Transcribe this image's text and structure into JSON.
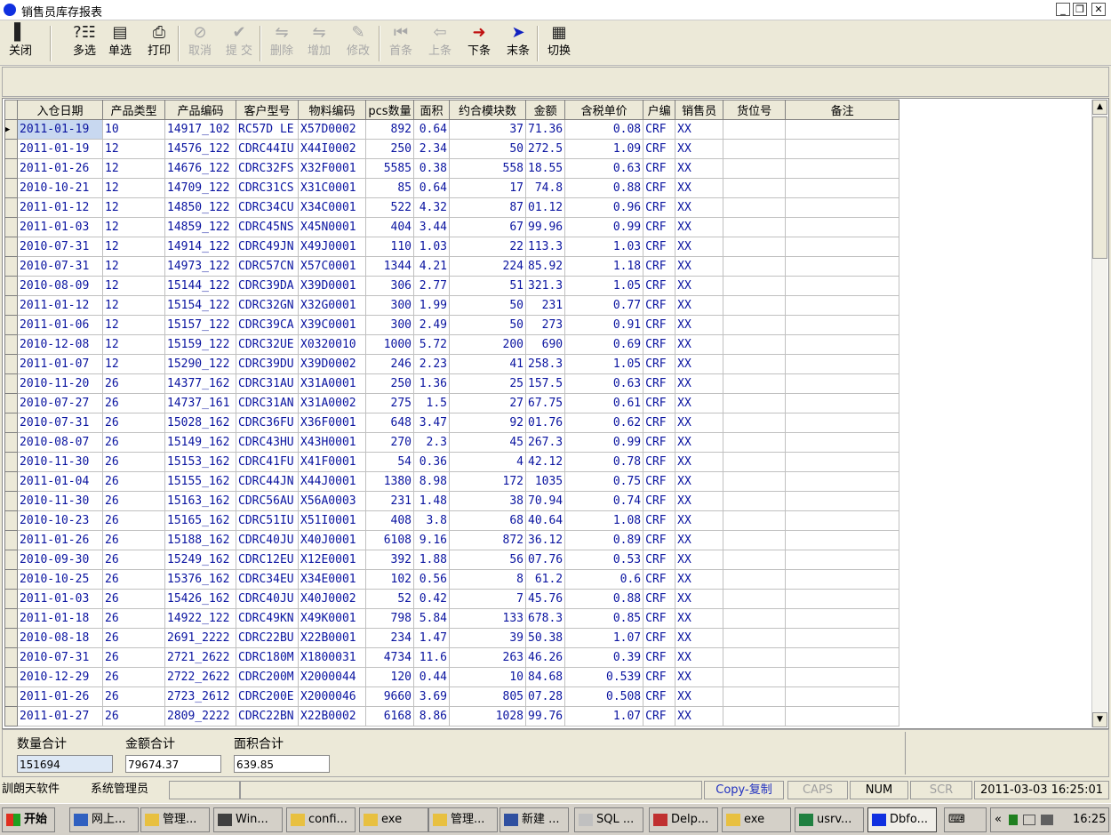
{
  "window": {
    "title": "销售员库存报表",
    "min": "_",
    "restore": "❐",
    "close": "✕"
  },
  "toolbar": [
    {
      "label": "关闭",
      "icon": "exit-door-icon",
      "glyph": "▌",
      "enabled": true
    },
    {
      "label": "多选",
      "icon": "multi-select-icon",
      "glyph": "?☷",
      "enabled": true
    },
    {
      "label": "单选",
      "icon": "single-select-icon",
      "glyph": "▤",
      "enabled": true
    },
    {
      "label": "打印",
      "icon": "printer-icon",
      "glyph": "⎙",
      "enabled": true
    },
    {
      "label": "取消",
      "icon": "cancel-icon",
      "glyph": "⊘",
      "enabled": false
    },
    {
      "label": "提 交",
      "icon": "checkmark-icon",
      "glyph": "✔",
      "enabled": false
    },
    {
      "label": "删除",
      "icon": "delete-row-icon",
      "glyph": "⇋",
      "enabled": false
    },
    {
      "label": "增加",
      "icon": "add-row-icon",
      "glyph": "⇋",
      "enabled": false
    },
    {
      "label": "修改",
      "icon": "edit-icon",
      "glyph": "✎",
      "enabled": false
    },
    {
      "label": "首条",
      "icon": "first-record-icon",
      "glyph": "⏮",
      "enabled": false
    },
    {
      "label": "上条",
      "icon": "prev-record-icon",
      "glyph": "⇦",
      "enabled": false
    },
    {
      "label": "下条",
      "icon": "next-record-icon",
      "glyph": "➜",
      "enabled": true
    },
    {
      "label": "末条",
      "icon": "last-record-icon",
      "glyph": "➤",
      "enabled": true
    },
    {
      "label": "切换",
      "icon": "grid-toggle-icon",
      "glyph": "▦",
      "enabled": true
    }
  ],
  "grid": {
    "columns": [
      "入仓日期",
      "产品类型",
      "产品编码",
      "客户型号",
      "物料编码",
      "pcs数量",
      "面积",
      "约合模块数",
      "金额",
      "含税单价",
      "户编",
      "销售员",
      "货位号",
      "备注"
    ],
    "rows": [
      [
        "2011-01-19",
        "10",
        "14917_102",
        "RC57D LE",
        "X57D0002",
        "892",
        "0.64",
        "37",
        "71.36",
        "0.08",
        "CRF",
        "XX",
        "",
        ""
      ],
      [
        "2011-01-19",
        "12",
        "14576_122",
        "CDRC44IU",
        "X44I0002",
        "250",
        "2.34",
        "50",
        "272.5",
        "1.09",
        "CRF",
        "XX",
        "",
        ""
      ],
      [
        "2011-01-26",
        "12",
        "14676_122",
        "CDRC32FS",
        "X32F0001",
        "5585",
        "0.38",
        "558",
        "18.55",
        "0.63",
        "CRF",
        "XX",
        "",
        ""
      ],
      [
        "2010-10-21",
        "12",
        "14709_122",
        "CDRC31CS",
        "X31C0001",
        "85",
        "0.64",
        "17",
        "74.8",
        "0.88",
        "CRF",
        "XX",
        "",
        ""
      ],
      [
        "2011-01-12",
        "12",
        "14850_122",
        "CDRC34CU",
        "X34C0001",
        "522",
        "4.32",
        "87",
        "01.12",
        "0.96",
        "CRF",
        "XX",
        "",
        ""
      ],
      [
        "2011-01-03",
        "12",
        "14859_122",
        "CDRC45NS",
        "X45N0001",
        "404",
        "3.44",
        "67",
        "99.96",
        "0.99",
        "CRF",
        "XX",
        "",
        ""
      ],
      [
        "2010-07-31",
        "12",
        "14914_122",
        "CDRC49JN",
        "X49J0001",
        "110",
        "1.03",
        "22",
        "113.3",
        "1.03",
        "CRF",
        "XX",
        "",
        ""
      ],
      [
        "2010-07-31",
        "12",
        "14973_122",
        "CDRC57CN",
        "X57C0001",
        "1344",
        "4.21",
        "224",
        "85.92",
        "1.18",
        "CRF",
        "XX",
        "",
        ""
      ],
      [
        "2010-08-09",
        "12",
        "15144_122",
        "CDRC39DA",
        "X39D0001",
        "306",
        "2.77",
        "51",
        "321.3",
        "1.05",
        "CRF",
        "XX",
        "",
        ""
      ],
      [
        "2011-01-12",
        "12",
        "15154_122",
        "CDRC32GN",
        "X32G0001",
        "300",
        "1.99",
        "50",
        "231",
        "0.77",
        "CRF",
        "XX",
        "",
        ""
      ],
      [
        "2011-01-06",
        "12",
        "15157_122",
        "CDRC39CA",
        "X39C0001",
        "300",
        "2.49",
        "50",
        "273",
        "0.91",
        "CRF",
        "XX",
        "",
        ""
      ],
      [
        "2010-12-08",
        "12",
        "15159_122",
        "CDRC32UE",
        "X0320010",
        "1000",
        "5.72",
        "200",
        "690",
        "0.69",
        "CRF",
        "XX",
        "",
        ""
      ],
      [
        "2011-01-07",
        "12",
        "15290_122",
        "CDRC39DU",
        "X39D0002",
        "246",
        "2.23",
        "41",
        "258.3",
        "1.05",
        "CRF",
        "XX",
        "",
        ""
      ],
      [
        "2010-11-20",
        "26",
        "14377_162",
        "CDRC31AU",
        "X31A0001",
        "250",
        "1.36",
        "25",
        "157.5",
        "0.63",
        "CRF",
        "XX",
        "",
        ""
      ],
      [
        "2010-07-27",
        "26",
        "14737_161",
        "CDRC31AN",
        "X31A0002",
        "275",
        "1.5",
        "27",
        "67.75",
        "0.61",
        "CRF",
        "XX",
        "",
        ""
      ],
      [
        "2010-07-31",
        "26",
        "15028_162",
        "CDRC36FU",
        "X36F0001",
        "648",
        "3.47",
        "92",
        "01.76",
        "0.62",
        "CRF",
        "XX",
        "",
        ""
      ],
      [
        "2010-08-07",
        "26",
        "15149_162",
        "CDRC43HU",
        "X43H0001",
        "270",
        "2.3",
        "45",
        "267.3",
        "0.99",
        "CRF",
        "XX",
        "",
        ""
      ],
      [
        "2010-11-30",
        "26",
        "15153_162",
        "CDRC41FU",
        "X41F0001",
        "54",
        "0.36",
        "4",
        "42.12",
        "0.78",
        "CRF",
        "XX",
        "",
        ""
      ],
      [
        "2011-01-04",
        "26",
        "15155_162",
        "CDRC44JN",
        "X44J0001",
        "1380",
        "8.98",
        "172",
        "1035",
        "0.75",
        "CRF",
        "XX",
        "",
        ""
      ],
      [
        "2010-11-30",
        "26",
        "15163_162",
        "CDRC56AU",
        "X56A0003",
        "231",
        "1.48",
        "38",
        "70.94",
        "0.74",
        "CRF",
        "XX",
        "",
        ""
      ],
      [
        "2010-10-23",
        "26",
        "15165_162",
        "CDRC51IU",
        "X51I0001",
        "408",
        "3.8",
        "68",
        "40.64",
        "1.08",
        "CRF",
        "XX",
        "",
        ""
      ],
      [
        "2011-01-26",
        "26",
        "15188_162",
        "CDRC40JU",
        "X40J0001",
        "6108",
        "9.16",
        "872",
        "36.12",
        "0.89",
        "CRF",
        "XX",
        "",
        ""
      ],
      [
        "2010-09-30",
        "26",
        "15249_162",
        "CDRC12EU",
        "X12E0001",
        "392",
        "1.88",
        "56",
        "07.76",
        "0.53",
        "CRF",
        "XX",
        "",
        ""
      ],
      [
        "2010-10-25",
        "26",
        "15376_162",
        "CDRC34EU",
        "X34E0001",
        "102",
        "0.56",
        "8",
        "61.2",
        "0.6",
        "CRF",
        "XX",
        "",
        ""
      ],
      [
        "2011-01-03",
        "26",
        "15426_162",
        "CDRC40JU",
        "X40J0002",
        "52",
        "0.42",
        "7",
        "45.76",
        "0.88",
        "CRF",
        "XX",
        "",
        ""
      ],
      [
        "2011-01-18",
        "26",
        "14922_122",
        "CDRC49KN",
        "X49K0001",
        "798",
        "5.84",
        "133",
        "678.3",
        "0.85",
        "CRF",
        "XX",
        "",
        ""
      ],
      [
        "2010-08-18",
        "26",
        "2691_2222",
        "CDRC22BU",
        "X22B0001",
        "234",
        "1.47",
        "39",
        "50.38",
        "1.07",
        "CRF",
        "XX",
        "",
        ""
      ],
      [
        "2010-07-31",
        "26",
        "2721_2622",
        "CDRC180M",
        "X1800031",
        "4734",
        "11.6",
        "263",
        "46.26",
        "0.39",
        "CRF",
        "XX",
        "",
        ""
      ],
      [
        "2010-12-29",
        "26",
        "2722_2622",
        "CDRC200M",
        "X2000044",
        "120",
        "0.44",
        "10",
        "84.68",
        "0.539",
        "CRF",
        "XX",
        "",
        ""
      ],
      [
        "2011-01-26",
        "26",
        "2723_2612",
        "CDRC200E",
        "X2000046",
        "9660",
        "3.69",
        "805",
        "07.28",
        "0.508",
        "CRF",
        "XX",
        "",
        ""
      ],
      [
        "2011-01-27",
        "26",
        "2809_2222",
        "CDRC22BN",
        "X22B0002",
        "6168",
        "8.86",
        "1028",
        "99.76",
        "1.07",
        "CRF",
        "XX",
        "",
        ""
      ]
    ]
  },
  "totals": {
    "qty_label": "数量合计",
    "qty_value": "151694",
    "amount_label": "金额合计",
    "amount_value": "79674.37",
    "area_label": "面积合计",
    "area_value": "639.85"
  },
  "status": {
    "company": "訓朗天软件",
    "user": "系统管理员",
    "copy": "Copy-复制",
    "caps": "CAPS",
    "num": "NUM",
    "scr": "SCR",
    "datetime": "2011-03-03 16:25:01"
  },
  "taskbar": {
    "start": "开始",
    "tasks": [
      "网上...",
      "管理...",
      "Win...",
      "confi...",
      "exe",
      "管理...",
      "新建 ...",
      "SQL ...",
      "Delp...",
      "exe",
      "usrv...",
      "Dbfo..."
    ],
    "tray_chevron": "«",
    "clock": "16:25"
  }
}
